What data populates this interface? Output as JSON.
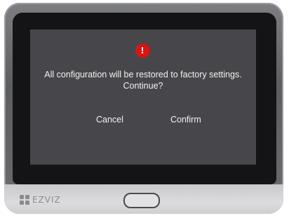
{
  "dialog": {
    "message": "All configuration will be restored to factory settings. Continue?",
    "cancel_label": "Cancel",
    "confirm_label": "Confirm",
    "icon": "warning-icon",
    "icon_glyph": "!",
    "icon_color": "#e3100f"
  },
  "device": {
    "brand": "EZVIZ",
    "home_button_icon": "home-button"
  }
}
